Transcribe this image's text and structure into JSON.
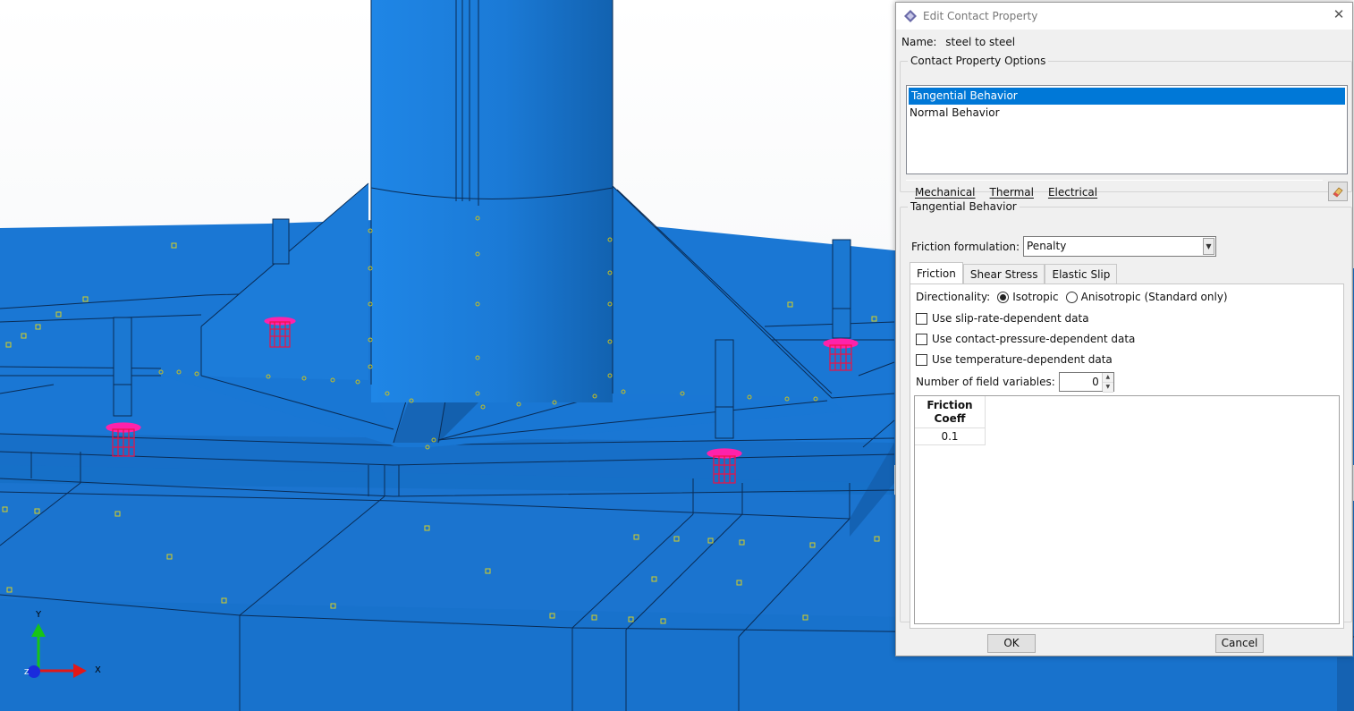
{
  "viewport": {
    "axis": {
      "y_label": "Y",
      "x_label": "X",
      "z_label": "Z"
    }
  },
  "dialog": {
    "title": "Edit Contact Property",
    "name_label": "Name:",
    "name_value": "steel to steel",
    "options_group": {
      "legend": "Contact Property Options",
      "items": [
        {
          "label": "Tangential Behavior",
          "selected": true
        },
        {
          "label": "Normal Behavior",
          "selected": false
        }
      ],
      "menus": [
        "Mechanical",
        "Thermal",
        "Electrical"
      ]
    },
    "behavior_group": {
      "legend": "Tangential Behavior",
      "friction_formulation_label": "Friction formulation:",
      "friction_formulation_value": "Penalty",
      "tabs": [
        {
          "label": "Friction",
          "active": true
        },
        {
          "label": "Shear Stress",
          "active": false
        },
        {
          "label": "Elastic Slip",
          "active": false
        }
      ],
      "directionality_label": "Directionality:",
      "isotropic_label": "Isotropic",
      "anisotropic_label": "Anisotropic (Standard only)",
      "checkboxes": [
        "Use slip-rate-dependent data",
        "Use contact-pressure-dependent data",
        "Use temperature-dependent data"
      ],
      "field_vars_label": "Number of field variables:",
      "field_vars_value": "0",
      "table": {
        "header_line1": "Friction",
        "header_line2": "Coeff",
        "value": "0.1"
      }
    },
    "ok_label": "OK",
    "cancel_label": "Cancel"
  }
}
